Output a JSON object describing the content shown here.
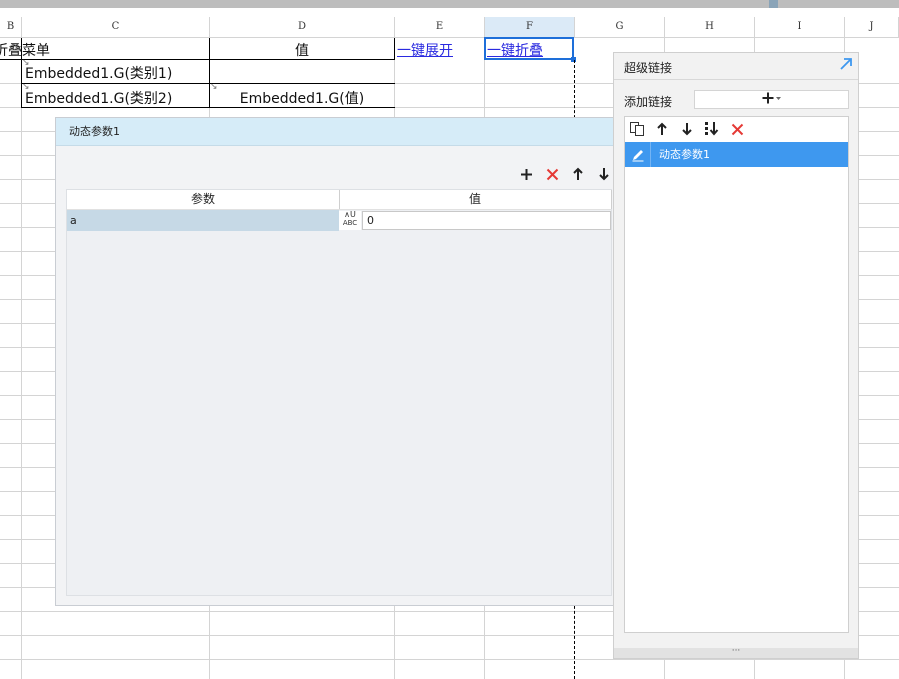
{
  "sheet": {
    "columns": [
      "B",
      "C",
      "D",
      "E",
      "F",
      "G",
      "H",
      "I",
      "J"
    ],
    "selected_column": "F",
    "cells": {
      "b1_partial": "折叠菜单",
      "d1": "值",
      "e1": "一键展开",
      "f1": "一键折叠",
      "c2": "Embedded1.G(类别1)",
      "c3": "Embedded1.G(类别2)",
      "d3": "Embedded1.G(值)"
    }
  },
  "dynamic_param_dialog": {
    "title": "动态参数1",
    "toolbar": {
      "add_icon": "plus-icon",
      "delete_icon": "close-red-icon",
      "up_icon": "arrow-up-icon",
      "down_icon": "arrow-down-icon"
    },
    "table": {
      "headers": [
        "参数",
        "值"
      ],
      "rows": [
        {
          "name": "a",
          "type_icon": "abc-type-icon",
          "type_text": "ABC",
          "value": "0"
        }
      ]
    }
  },
  "hyperlink_panel": {
    "title": "超级链接",
    "add_label": "添加链接",
    "items": [
      {
        "label": "动态参数1",
        "selected": true
      }
    ]
  },
  "colors": {
    "accent_blue": "#3e98ef",
    "selection_border": "#1e6fd9",
    "dialog_title_bg": "#d6ecf8",
    "delete_red": "#e53935"
  }
}
